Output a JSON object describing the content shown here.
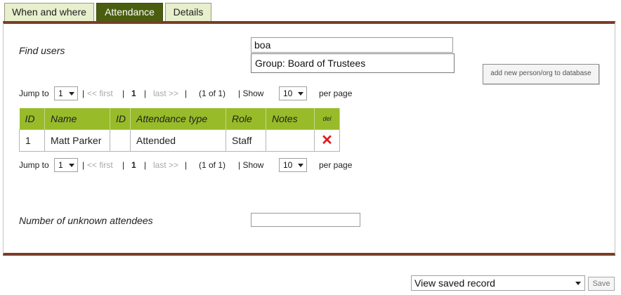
{
  "tabs": [
    {
      "label": "When and where",
      "active": false
    },
    {
      "label": "Attendance",
      "active": true
    },
    {
      "label": "Details",
      "active": false
    }
  ],
  "find_users": {
    "label": "Find users",
    "search_value": "boa",
    "suggestion": "Group: Board of Trustees",
    "add_button_label": "add new person/org to database"
  },
  "pager": {
    "jump_to_label": "Jump to",
    "page_value": "1",
    "sep1": "|",
    "first_label": "<< first",
    "sep2": "|",
    "current_page": "1",
    "sep3": "|",
    "last_label": "last >>",
    "sep4": "|",
    "count_text": "(1 of 1)",
    "show_label": "| Show",
    "per_page_value": "10",
    "per_page_label": "per page"
  },
  "table": {
    "headers": [
      "ID",
      "Name",
      "ID",
      "Attendance type",
      "Role",
      "Notes",
      "del"
    ],
    "rows": [
      {
        "id": "1",
        "name": "Matt Parker",
        "id2": "",
        "attendance_type": "Attended",
        "role": "Staff",
        "notes": ""
      }
    ]
  },
  "unknown_attendees": {
    "label": "Number of unknown attendees",
    "value": ""
  },
  "footer": {
    "view_saved_record": "View saved record",
    "save_label": "Save"
  },
  "colors": {
    "active_tab": "#4b5e0f",
    "inactive_tab": "#e7efcd",
    "table_header": "#98bb2a",
    "panel_border": "#7a3d27",
    "delete_icon": "#e01a1a"
  }
}
